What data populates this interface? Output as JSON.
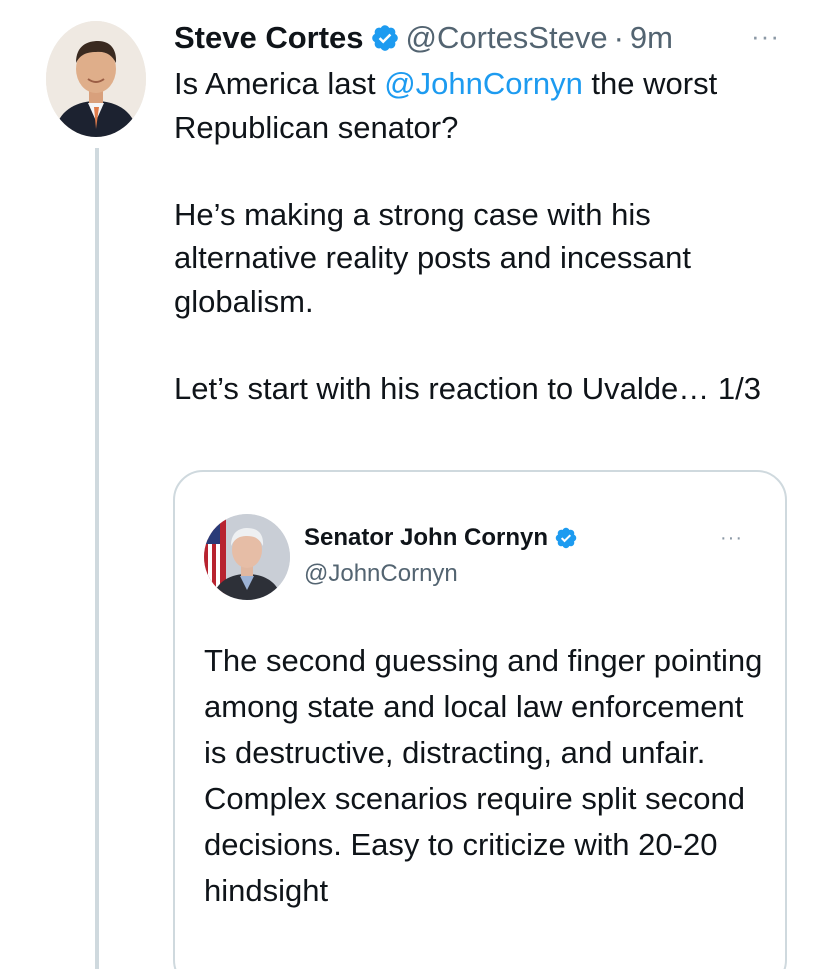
{
  "tweet": {
    "author": {
      "display_name": "Steve Cortes",
      "handle": "@CortesSteve",
      "verified": true,
      "avatar_icon": "profile-photo-icon"
    },
    "separator": "·",
    "time": "9m",
    "more_label": "···",
    "text": {
      "line1_prefix": "Is America last ",
      "mention": "@JohnCornyn",
      "line1_suffix": " the worst Republican senator?",
      "para2": "He’s making a strong case with his alternative reality posts and incessant globalism.",
      "para3": "Let’s start with his reaction to Uvalde… 1/3"
    },
    "quoted_tweet": {
      "author": {
        "display_name": "Senator John Cornyn",
        "handle": "@JohnCornyn",
        "verified": true,
        "avatar_icon": "profile-photo-icon"
      },
      "more_label": "···",
      "text": "The second guessing and finger pointing among state and local law enforcement is destructive, distracting, and unfair.  Complex scenarios require split second decisions. Easy to criticize with 20-20 hindsight"
    }
  },
  "colors": {
    "link": "#1d9bf0",
    "secondary_text": "#536471",
    "border": "#cfd9de",
    "verified_badge": "#1d9bf0"
  }
}
